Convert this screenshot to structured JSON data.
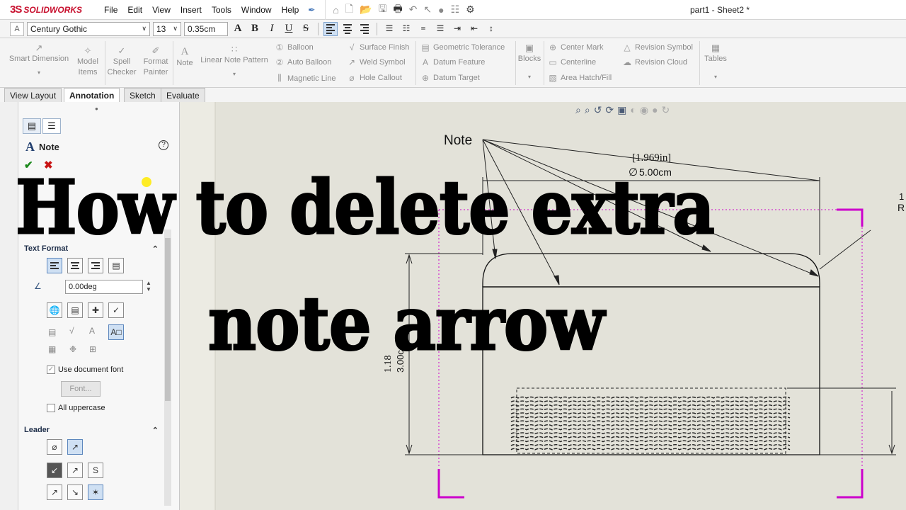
{
  "app": {
    "brand": "SOLIDWORKS",
    "document_title": "part1 - Sheet2 *",
    "menus": [
      "File",
      "Edit",
      "View",
      "Insert",
      "Tools",
      "Window",
      "Help"
    ]
  },
  "format_bar": {
    "font": "Century Gothic",
    "size": "13",
    "height": "0.35cm",
    "bold": "B",
    "italic": "I",
    "underline": "U",
    "strike": "S"
  },
  "ribbon": {
    "smart_dimension": "Smart Dimension",
    "model_items": [
      "Model",
      "Items"
    ],
    "spell_checker": [
      "Spell",
      "Checker"
    ],
    "format_painter": [
      "Format",
      "Painter"
    ],
    "note": "Note",
    "linear_note_pattern": "Linear Note Pattern",
    "balloon": "Balloon",
    "auto_balloon": "Auto Balloon",
    "magnetic_line": "Magnetic Line",
    "surface_finish": "Surface Finish",
    "weld_symbol": "Weld Symbol",
    "hole_callout": "Hole Callout",
    "geometric_tolerance": "Geometric Tolerance",
    "datum_feature": "Datum Feature",
    "datum_target": "Datum Target",
    "blocks": "Blocks",
    "center_mark": "Center Mark",
    "centerline": "Centerline",
    "area_hatch": "Area Hatch/Fill",
    "revision_symbol": "Revision Symbol",
    "revision_cloud": "Revision Cloud",
    "tables": "Tables"
  },
  "tabs": [
    {
      "label": "View Layout",
      "active": false
    },
    {
      "label": "Annotation",
      "active": true
    },
    {
      "label": "Sketch",
      "active": false
    },
    {
      "label": "Evaluate",
      "active": false
    }
  ],
  "panel": {
    "title": "Note",
    "help": "?",
    "text_format": {
      "header": "Text Format",
      "angle": "0.00deg",
      "use_document_font": "Use document font",
      "font_button": "Font...",
      "all_uppercase": "All uppercase"
    },
    "leader": {
      "header": "Leader"
    }
  },
  "drawing": {
    "note_label": "Note",
    "dim_top_alt": "1.969in",
    "dim_top": "5.00cm",
    "dim_left_alt": "1.18",
    "dim_left": "3.00c",
    "dim_right_partial": "1",
    "dim_right_partial2": "R"
  },
  "overlay": {
    "line1": "How to delete extra",
    "line2": "note arrow"
  },
  "colors": {
    "brand_red": "#c8102e",
    "sheet_bg": "#e3e2d9",
    "selection_magenta": "#cc00cc",
    "accent_blue": "#cfe0f3"
  }
}
